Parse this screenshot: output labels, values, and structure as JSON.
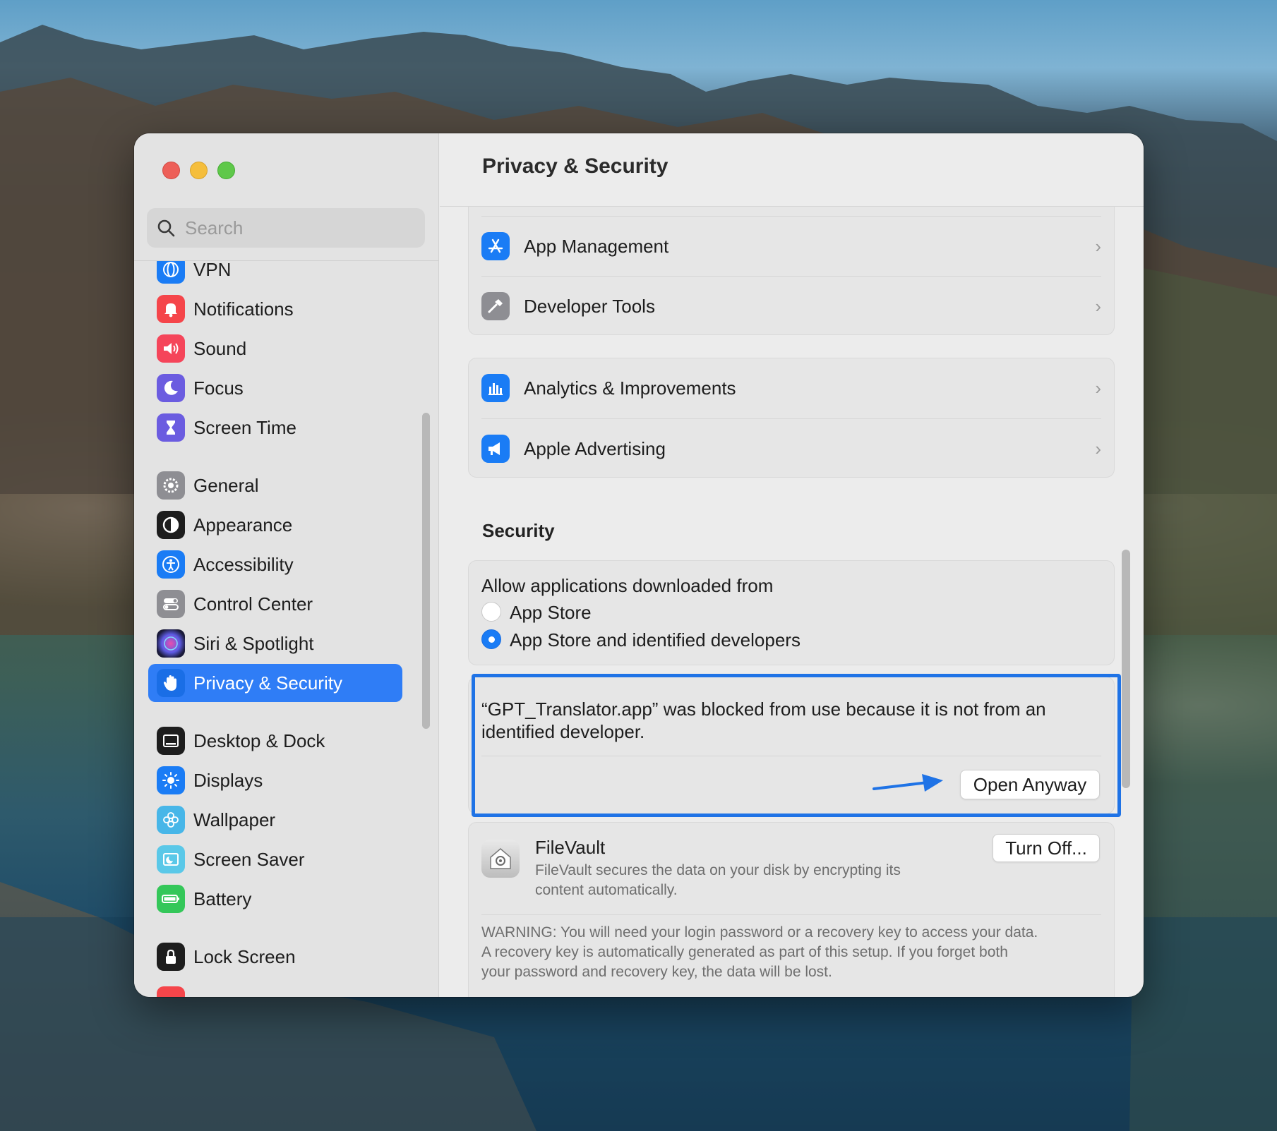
{
  "window": {
    "title": "Privacy & Security"
  },
  "sidebar": {
    "search_placeholder": "Search",
    "partial_top_label": "VPN",
    "items": [
      {
        "label": "Notifications",
        "icon": "bell-icon",
        "color": "#f5454a"
      },
      {
        "label": "Sound",
        "icon": "speaker-icon",
        "color": "#f5455a"
      },
      {
        "label": "Focus",
        "icon": "moon-icon",
        "color": "#6b5ce0"
      },
      {
        "label": "Screen Time",
        "icon": "hourglass-icon",
        "color": "#6b5ce0"
      },
      {
        "label": "General",
        "icon": "gear-icon",
        "color": "#8e8e93"
      },
      {
        "label": "Appearance",
        "icon": "appearance-icon",
        "color": "#1d1d1d"
      },
      {
        "label": "Accessibility",
        "icon": "accessibility-icon",
        "color": "#1a7cf5"
      },
      {
        "label": "Control Center",
        "icon": "toggles-icon",
        "color": "#8e8e93"
      },
      {
        "label": "Siri & Spotlight",
        "icon": "siri-icon",
        "color": "#2b2b4b"
      },
      {
        "label": "Privacy & Security",
        "icon": "hand-icon",
        "color": "#1a7cf5"
      },
      {
        "label": "Desktop & Dock",
        "icon": "dock-icon",
        "color": "#1d1d1d"
      },
      {
        "label": "Displays",
        "icon": "sun-icon",
        "color": "#1a7cf5"
      },
      {
        "label": "Wallpaper",
        "icon": "flower-icon",
        "color": "#47b6e8"
      },
      {
        "label": "Screen Saver",
        "icon": "screensaver-icon",
        "color": "#5ac8e8"
      },
      {
        "label": "Battery",
        "icon": "battery-icon",
        "color": "#34c759"
      },
      {
        "label": "Lock Screen",
        "icon": "lock-icon",
        "color": "#1d1d1d"
      }
    ]
  },
  "main": {
    "title": "Privacy & Security",
    "group1": [
      {
        "label": "App Management",
        "icon": "app-store-icon",
        "color": "#1a7cf5"
      },
      {
        "label": "Developer Tools",
        "icon": "hammer-icon",
        "color": "#8e8e93"
      }
    ],
    "group2": [
      {
        "label": "Analytics & Improvements",
        "icon": "chart-icon",
        "color": "#1a7cf5"
      },
      {
        "label": "Apple Advertising",
        "icon": "megaphone-icon",
        "color": "#1a7cf5"
      }
    ],
    "chevron": "›",
    "security": {
      "title": "Security",
      "allow_label": "Allow applications downloaded from",
      "options": [
        "App Store",
        "App Store and identified developers"
      ],
      "selected_index": 1
    },
    "blocked": {
      "message_line1": "“GPT_Translator.app” was blocked from use because it is not from an",
      "message_line2": "identified developer.",
      "button": "Open Anyway"
    },
    "filevault": {
      "title": "FileVault",
      "desc_line1": "FileVault secures the data on your disk by encrypting its",
      "desc_line2": "content automatically.",
      "button": "Turn Off...",
      "warning_line1": "WARNING: You will need your login password or a recovery key to access your data.",
      "warning_line2": "A recovery key is automatically generated as part of this setup. If you forget both",
      "warning_line3": "your password and recovery key, the data will be lost."
    }
  },
  "colors": {
    "accent": "#2f7df6",
    "highlight_border": "#1f73e6"
  }
}
